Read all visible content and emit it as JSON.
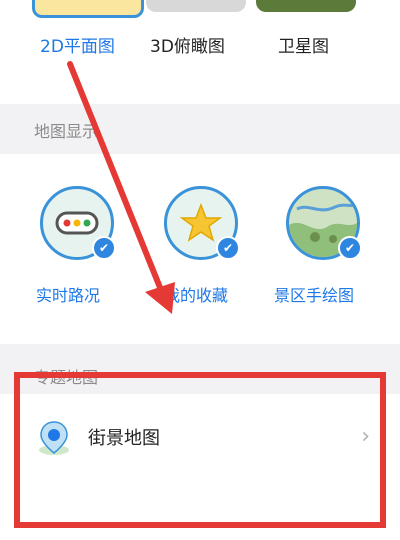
{
  "map_types": {
    "items": [
      {
        "label": "2D平面图",
        "active": true
      },
      {
        "label": "3D俯瞰图",
        "active": false
      },
      {
        "label": "卫星图",
        "active": false
      }
    ]
  },
  "map_display": {
    "title": "地图显示",
    "layers": [
      {
        "label": "实时路况"
      },
      {
        "label": "我的收藏"
      },
      {
        "label": "景区手绘图"
      }
    ]
  },
  "theme_maps": {
    "title": "专题地图",
    "items": [
      {
        "label": "街景地图",
        "chevron": "›"
      }
    ]
  },
  "colors": {
    "accent": "#1e78e6",
    "highlight": "#e53935"
  }
}
